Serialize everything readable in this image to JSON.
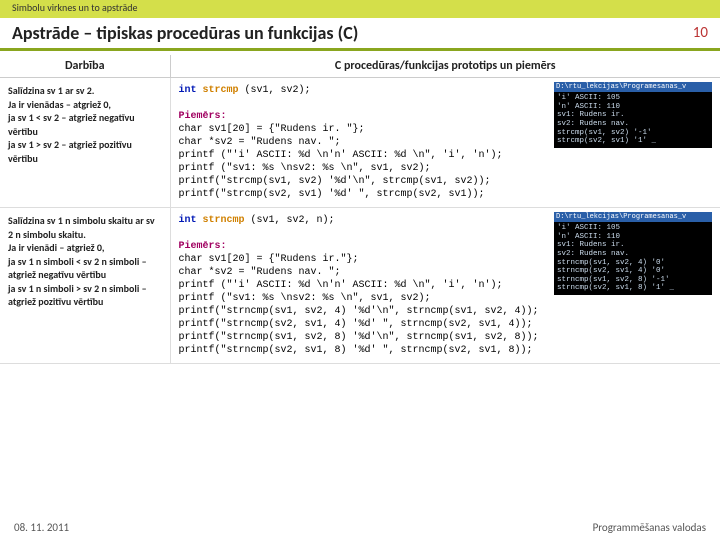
{
  "topbar": "Simbolu virknes un to apstrāde",
  "title": "Apstrāde – tipiskas procedūras un funkcijas (C)",
  "pagenum": "10",
  "th": {
    "action": "Darbība",
    "proto": "C procedūras/funkcijas prototips un piemērs"
  },
  "r1": {
    "d1": "Salīdzina sv 1 ar sv 2.",
    "d2": "Ja ir vienādas – atgriež 0,",
    "d3": "ja sv 1 < sv 2 – atgriež negatīvu vērtību",
    "d4": "ja sv 1 > sv 2 – atgriež pozitīvu vērtību",
    "kw": "int",
    "fn": "strcmp",
    "sig": " (sv1, sv2);",
    "ex": "Piemērs:",
    "c1": "char sv1[20] = {\"Rudens ir. \"};",
    "c2": "char *sv2 = \"Rudens nav. \";",
    "c3": "printf (\"'i' ASCII: %d \\n'n' ASCII: %d \\n\", 'i', 'n');",
    "c4": "printf (\"sv1: %s \\nsv2: %s \\n\", sv1, sv2);",
    "c5": "printf(\"strcmp(sv1, sv2) '%d'\\n\", strcmp(sv1, sv2));",
    "c6": "printf(\"strcmp(sv2, sv1) '%d' \", strcmp(sv2, sv1));",
    "thdr": "D:\\rtu_lekcijas\\Programesanas_v",
    "t1": "'i' ASCII: 105",
    "t2": "'n' ASCII: 110",
    "t3": "sv1: Rudens ir.",
    "t4": "sv2: Rudens nav.",
    "t5": "strcmp(sv1, sv2) '-1'",
    "t6": "strcmp(sv2, sv1) '1' _"
  },
  "r2": {
    "d1": "Salīdzina sv 1 n simbolu skaitu ar sv 2 n simbolu skaitu.",
    "d2": "Ja ir vienādi – atgriež 0,",
    "d3": "ja sv 1 n simboli < sv 2 n simboli – atgriež negatīvu vērtību",
    "d4": "ja sv 1 n simboli > sv 2 n simboli – atgriež pozitīvu vērtību",
    "kw": "int",
    "fn": "strncmp",
    "sig": " (sv1, sv2, n);",
    "ex": "Piemērs:",
    "c1": "char sv1[20] = {\"Rudens ir.\"};",
    "c2": "char *sv2 = \"Rudens nav. \";",
    "c3": "printf (\"'i' ASCII: %d \\n'n' ASCII: %d \\n\", 'i', 'n');",
    "c4": "printf (\"sv1: %s \\nsv2: %s \\n\", sv1, sv2);",
    "c5": "printf(\"strncmp(sv1, sv2, 4) '%d'\\n\", strncmp(sv1, sv2, 4));",
    "c6": "printf(\"strncmp(sv2, sv1, 4) '%d' \", strncmp(sv2, sv1, 4));",
    "c7": "printf(\"strncmp(sv1, sv2, 8) '%d'\\n\", strncmp(sv1, sv2, 8));",
    "c8": "printf(\"strncmp(sv2, sv1, 8) '%d' \", strncmp(sv2, sv1, 8));",
    "thdr": "D:\\rtu_lekcijas\\Programesanas_v",
    "t1": "'i' ASCII: 105",
    "t2": "'n' ASCII: 110",
    "t3": "sv1: Rudens ir.",
    "t4": "sv2: Rudens nav.",
    "t5": "strncmp(sv1, sv2, 4) '0'",
    "t6": "strncmp(sv2, sv1, 4) '0'",
    "t7": "strncmp(sv1, sv2, 8) '-1'",
    "t8": "strncmp(sv2, sv1, 8) '1' _"
  },
  "footer": {
    "date": "08. 11. 2011",
    "course": "Programmēšanas valodas"
  }
}
